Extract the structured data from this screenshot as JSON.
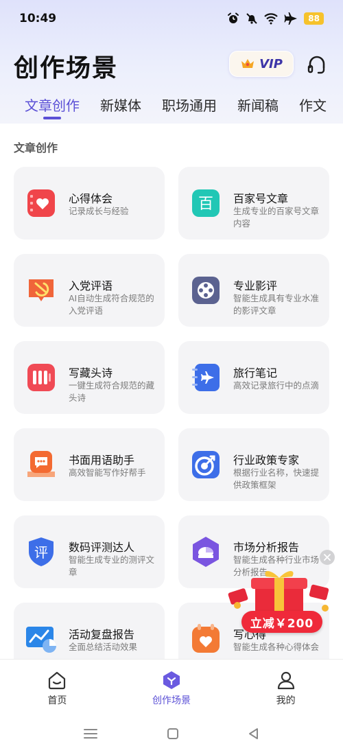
{
  "status": {
    "time": "10:49",
    "battery": "88"
  },
  "header": {
    "title": "创作场景",
    "vip_label": "VIP"
  },
  "tabs": [
    {
      "label": "文章创作",
      "active": true
    },
    {
      "label": "新媒体",
      "active": false
    },
    {
      "label": "职场通用",
      "active": false
    },
    {
      "label": "新闻稿",
      "active": false
    },
    {
      "label": "作文",
      "active": false
    }
  ],
  "section": {
    "title": "文章创作"
  },
  "cards": [
    {
      "title": "心得体会",
      "desc": "记录成长与经验",
      "icon": "heart-notebook-icon",
      "color": "#f0454a"
    },
    {
      "title": "百家号文章",
      "desc": "生成专业的百家号文章内容",
      "icon": "baijiahao-icon",
      "color": "#21c7b5"
    },
    {
      "title": "入党评语",
      "desc": "AI自动生成符合规范的入党评语",
      "icon": "party-emblem-icon",
      "color": "#f0653a"
    },
    {
      "title": "专业影评",
      "desc": "智能生成具有专业水准的影评文章",
      "icon": "film-reel-icon",
      "color": "#5b6290"
    },
    {
      "title": "写藏头诗",
      "desc": "一键生成符合规范的藏头诗",
      "icon": "poem-scroll-icon",
      "color": "#f04a55"
    },
    {
      "title": "旅行笔记",
      "desc": "高效记录旅行中的点滴",
      "icon": "airplane-notebook-icon",
      "color": "#3d6ee8"
    },
    {
      "title": "书面用语助手",
      "desc": "高效智能写作好帮手",
      "icon": "chat-book-icon",
      "color": "#f36a32"
    },
    {
      "title": "行业政策专家",
      "desc": "根据行业名称，快速提供政策框架",
      "icon": "target-icon",
      "color": "#3d6ee8"
    },
    {
      "title": "数码评测达人",
      "desc": "智能生成专业的测评文章",
      "icon": "shield-review-icon",
      "color": "#3d6ee8"
    },
    {
      "title": "市场分析报告",
      "desc": "智能生成各种行业市场分析报告",
      "icon": "hexagon-chart-icon",
      "color": "#7a55e0"
    },
    {
      "title": "活动复盘报告",
      "desc": "全面总结活动效果",
      "icon": "presentation-chart-icon",
      "color": "#2b86e8"
    },
    {
      "title": "写心得",
      "desc": "智能生成各种心得体会",
      "icon": "heart-clipboard-icon",
      "color": "#f37a35"
    }
  ],
  "promo": {
    "label": "立减￥200"
  },
  "nav": [
    {
      "label": "首页",
      "icon": "home-icon",
      "active": false
    },
    {
      "label": "创作场景",
      "icon": "create-hexagon-icon",
      "active": true
    },
    {
      "label": "我的",
      "icon": "person-icon",
      "active": false
    }
  ]
}
